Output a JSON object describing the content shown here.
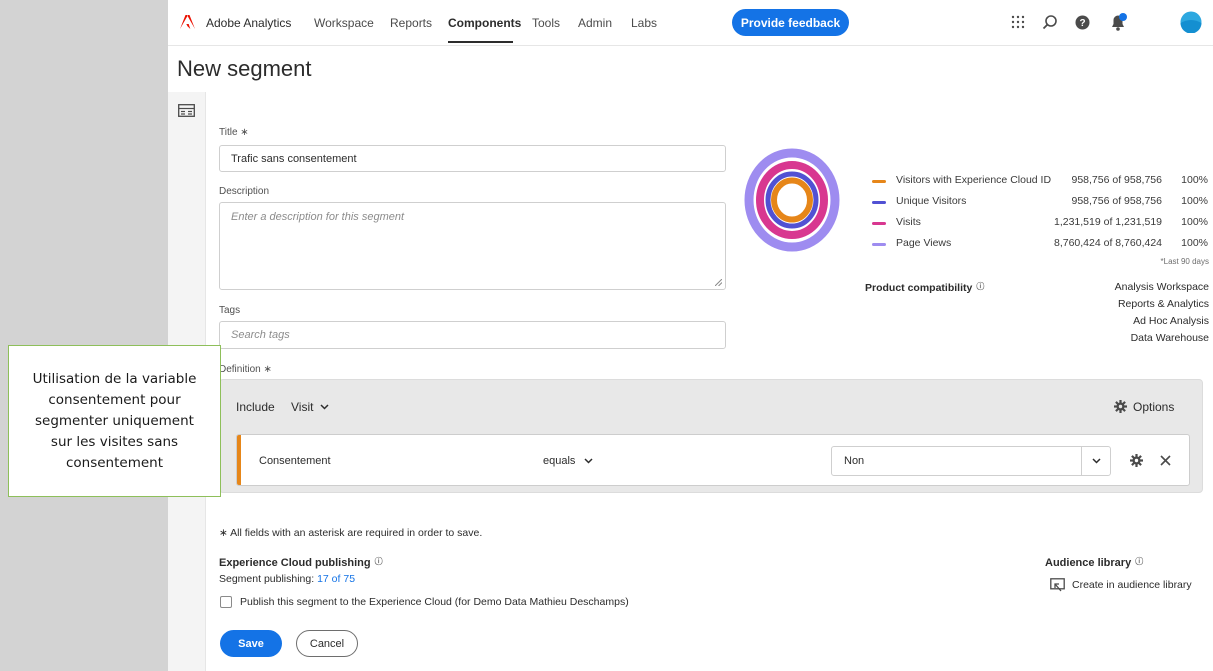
{
  "app": {
    "brand": "Adobe Analytics",
    "brand_color": "#eb1000",
    "accent_color": "#1473e6"
  },
  "nav": {
    "items": [
      "Workspace",
      "Reports",
      "Components",
      "Tools",
      "Admin",
      "Labs"
    ],
    "active": "Components",
    "feedback_label": "Provide feedback"
  },
  "icons": {
    "apps": "grid-icon",
    "search": "search-icon",
    "help": "help-icon",
    "notifications": "bell-icon",
    "avatar": "avatar-icon",
    "rail": "layout-icon",
    "options": "gear-icon",
    "audience": "audience-icon"
  },
  "page": {
    "title": "New segment"
  },
  "form": {
    "title_label": "Title ∗",
    "title_value": "Trafic sans consentement",
    "description_label": "Description",
    "description_placeholder": "Enter a description for this segment",
    "tags_label": "Tags",
    "tags_placeholder": "Search tags",
    "definition_label": "Definition ∗"
  },
  "summary": {
    "legend": [
      {
        "name": "Visitors with Experience Cloud ID",
        "value": "958,756 of 958,756",
        "percent": "100%",
        "color": "#e68619"
      },
      {
        "name": "Unique Visitors",
        "value": "958,756 of 958,756",
        "percent": "100%",
        "color": "#5151d3"
      },
      {
        "name": "Visits",
        "value": "1,231,519 of 1,231,519",
        "percent": "100%",
        "color": "#d83790"
      },
      {
        "name": "Page Views",
        "value": "8,760,424 of 8,760,424",
        "percent": "100%",
        "color": "#9e8cf0"
      }
    ],
    "period_note": "*Last 90 days",
    "compat_label": "Product compatibility",
    "compat_products": [
      "Analysis Workspace",
      "Reports & Analytics",
      "Ad Hoc Analysis",
      "Data Warehouse"
    ]
  },
  "definition": {
    "include_label": "Include",
    "container": "Visit",
    "options_label": "Options",
    "condition": {
      "dimension": "Consentement",
      "operator": "equals",
      "value": "Non"
    }
  },
  "footer": {
    "required_note": "∗ All fields with an asterisk are required in order to save.",
    "ecp_label": "Experience Cloud publishing",
    "segment_publishing_label": "Segment publishing:",
    "segment_publishing_count": "17 of 75",
    "publish_checkbox_label": "Publish this segment to the Experience Cloud (for Demo Data Mathieu Deschamps)",
    "publish_checked": false,
    "audience_label": "Audience library",
    "audience_create": "Create in audience library",
    "save_label": "Save",
    "cancel_label": "Cancel"
  },
  "annotation": {
    "text": "Utilisation de la variable\nconsentement pour\nsegmenter uniquement\nsur les visites sans\nconsentement",
    "border_color": "#8ebf5a"
  }
}
